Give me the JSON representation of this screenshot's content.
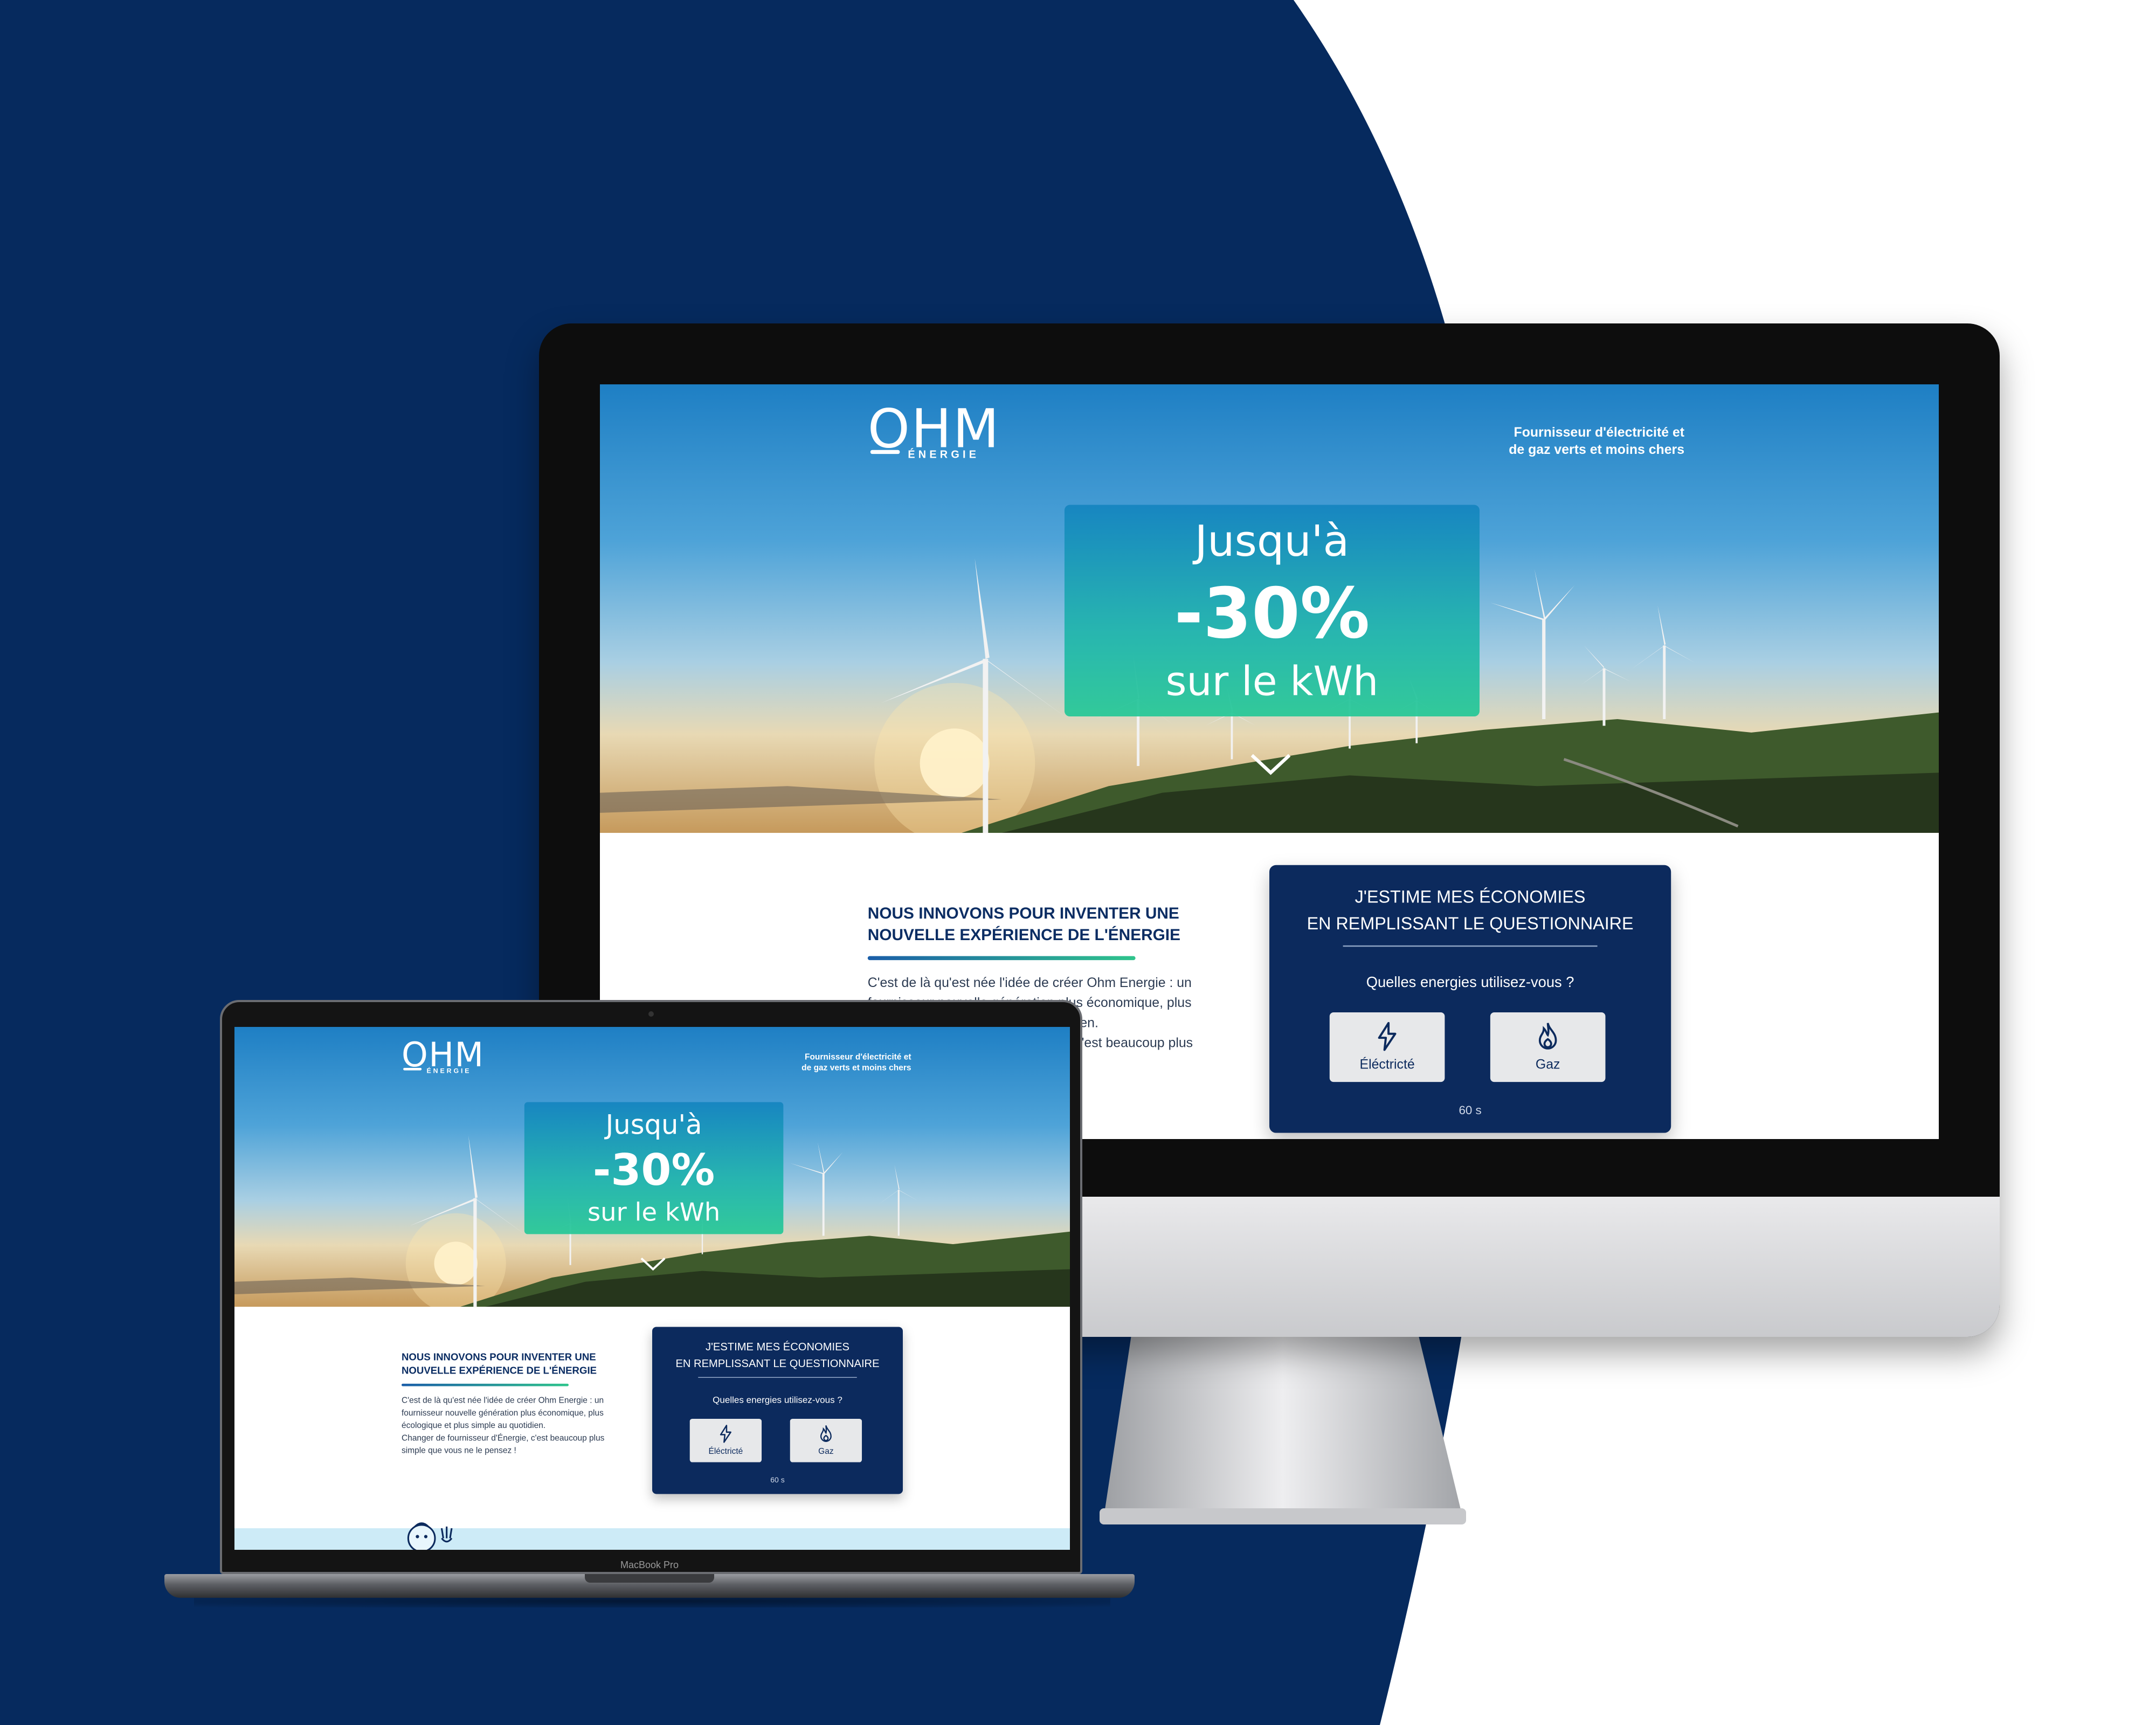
{
  "colors": {
    "navy": "#062a5e",
    "card_navy": "#0c2a5d",
    "accent_green": "#2fc48c",
    "white": "#ffffff"
  },
  "site": {
    "logo_main": "OHM",
    "logo_sub": "ÉNERGIE",
    "tagline": [
      "Fournisseur d'électricité et",
      "de gaz verts et moins chers"
    ],
    "promo": {
      "line1": "Jusqu'à",
      "line2": "-30%",
      "line3": "sur le kWh"
    },
    "intro_title": [
      "NOUS INNOVONS POUR INVENTER UNE",
      "NOUVELLE EXPÉRIENCE DE L'ÉNERGIE"
    ],
    "intro_text": [
      "C'est de là qu'est née l'idée de créer Ohm Energie : un",
      "fournisseur nouvelle génération plus économique, plus",
      "écologique et plus simple au quotidien.",
      "Changer de fournisseur d'Énergie, c'est beaucoup plus",
      "simple que vous ne le pensez !"
    ],
    "quiz": {
      "title": [
        "J'ESTIME MES ÉCONOMIES",
        "EN REMPLISSANT LE QUESTIONNAIRE"
      ],
      "question": "Quelles energies utilisez-vous ?",
      "options": [
        {
          "label": "Éléctricté",
          "icon": "lightning-icon"
        },
        {
          "label": "Gaz",
          "icon": "flame-icon"
        }
      ],
      "timer": "60 s"
    }
  },
  "devices": {
    "laptop_brand": "MacBook Pro"
  }
}
